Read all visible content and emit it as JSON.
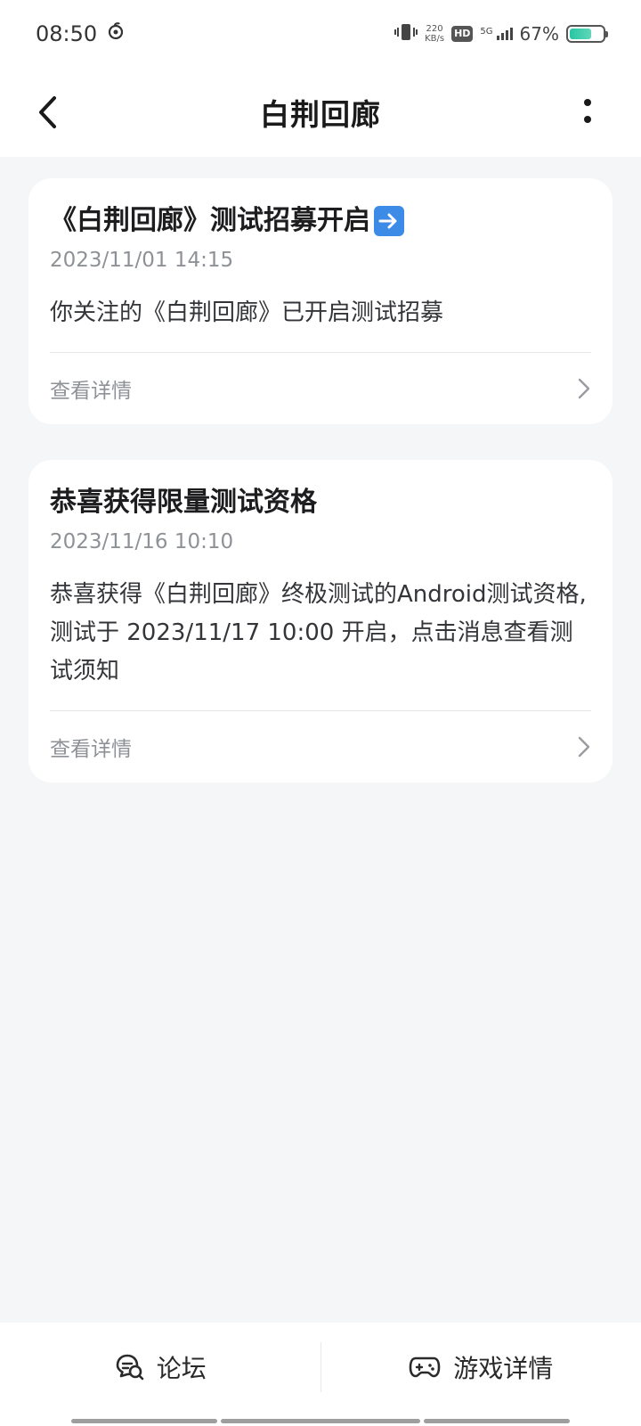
{
  "status_bar": {
    "time": "08:50",
    "speed_value": "220",
    "speed_unit": "KB/s",
    "hd": "HD",
    "network": "5G",
    "battery": "67%",
    "battery_level": 0.67
  },
  "header": {
    "title": "白荆回廊"
  },
  "cards": [
    {
      "title": "《白荆回廊》测试招募开启",
      "has_arrow_emoji": true,
      "time": "2023/11/01 14:15",
      "body": "你关注的《白荆回廊》已开启测试招募",
      "detail_label": "查看详情"
    },
    {
      "title": "恭喜获得限量测试资格",
      "has_arrow_emoji": false,
      "time": "2023/11/16 10:10",
      "body": "恭喜获得《白荆回廊》终极测试的Android测试资格,测试于 2023/11/17 10:00 开启，点击消息查看测试须知",
      "detail_label": "查看详情"
    }
  ],
  "bottom_bar": {
    "forum_label": "论坛",
    "game_detail_label": "游戏详情"
  },
  "colors": {
    "accent_battery": "#26c6a5",
    "background": "#f4f6f8",
    "card": "#ffffff",
    "muted_text": "#8e9196"
  }
}
